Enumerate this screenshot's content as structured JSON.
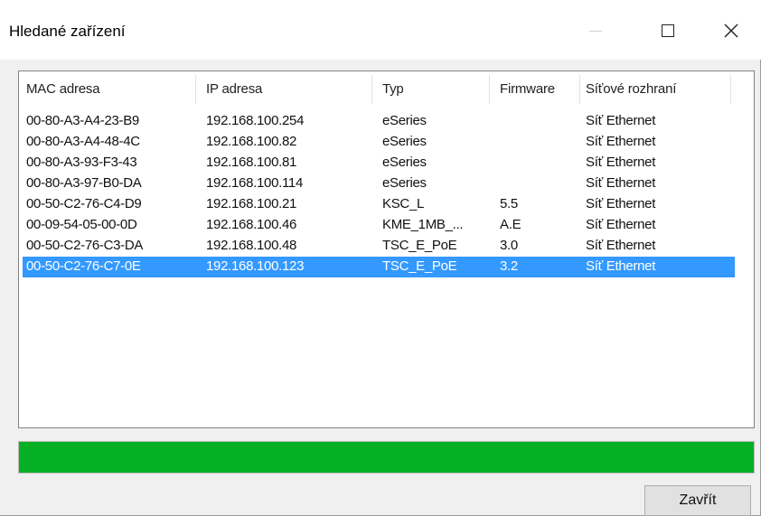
{
  "window": {
    "title": "Hledané zařízení",
    "controls": {
      "minimize": "—",
      "maximize": "☐",
      "close": "✕"
    }
  },
  "table": {
    "columns": [
      "MAC adresa",
      "IP adresa",
      "Typ",
      "Firmware",
      "Síťové rozhraní"
    ],
    "rows": [
      [
        "00-80-A3-A4-23-B9",
        "192.168.100.254",
        "eSeries",
        "",
        "Síť Ethernet"
      ],
      [
        "00-80-A3-A4-48-4C",
        "192.168.100.82",
        "eSeries",
        "",
        "Síť Ethernet"
      ],
      [
        "00-80-A3-93-F3-43",
        "192.168.100.81",
        "eSeries",
        "",
        "Síť Ethernet"
      ],
      [
        "00-80-A3-97-B0-DA",
        "192.168.100.114",
        "eSeries",
        "",
        "Síť Ethernet"
      ],
      [
        "00-50-C2-76-C4-D9",
        "192.168.100.21",
        "KSC_L",
        "5.5",
        "Síť Ethernet"
      ],
      [
        "00-09-54-05-00-0D",
        "192.168.100.46",
        "KME_1MB_...",
        "A.E",
        "Síť Ethernet"
      ],
      [
        "00-50-C2-76-C3-DA",
        "192.168.100.48",
        "TSC_E_PoE",
        "3.0",
        "Síť Ethernet"
      ],
      [
        "00-50-C2-76-C7-0E",
        "192.168.100.123",
        "TSC_E_PoE",
        "3.2",
        "Síť Ethernet"
      ]
    ],
    "selected_row": 7
  },
  "progress": {
    "value": 1.0,
    "color": "#06b025"
  },
  "buttons": {
    "close_label": "Zavřít"
  },
  "colors": {
    "selection": "#3399ff",
    "progress": "#06b025"
  }
}
